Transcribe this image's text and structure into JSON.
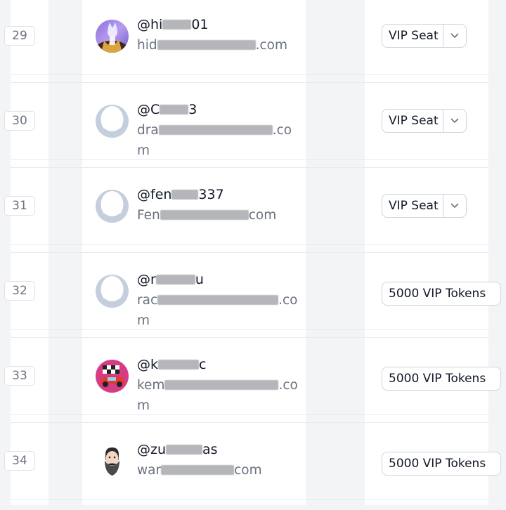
{
  "rows": [
    {
      "number": "29",
      "handle_start": "@hi",
      "handle_end": "01",
      "email_start": "hid",
      "email_end": ".com",
      "plan_label": "VIP Seat",
      "avatar": "fantasy-character-avatar"
    },
    {
      "number": "30",
      "handle_start": "@C",
      "handle_end": "3",
      "email_start": "dra",
      "email_end": ".co​m",
      "plan_label": "VIP Seat",
      "avatar": "default-user-avatar"
    },
    {
      "number": "31",
      "handle_start": "@fen",
      "handle_end": "337",
      "email_start": "Fen",
      "email_end": "com",
      "plan_label": "VIP Seat",
      "avatar": "default-user-avatar"
    },
    {
      "number": "32",
      "handle_start": "@r",
      "handle_end": "u",
      "email_start": "rac",
      "email_end": ".c​om",
      "plan_label": "5000 VIP Tokens",
      "avatar": "default-user-avatar"
    },
    {
      "number": "33",
      "handle_start": "@k",
      "handle_end": "c",
      "email_start": "kem",
      "email_end": ".c​om",
      "plan_label": "5000 VIP Tokens",
      "avatar": "race-car-avatar"
    },
    {
      "number": "34",
      "handle_start": "@zu",
      "handle_end": "as",
      "email_start": "war",
      "email_end": "com",
      "plan_label": "5000 VIP Tokens",
      "avatar": "bearded-man-avatar"
    }
  ]
}
